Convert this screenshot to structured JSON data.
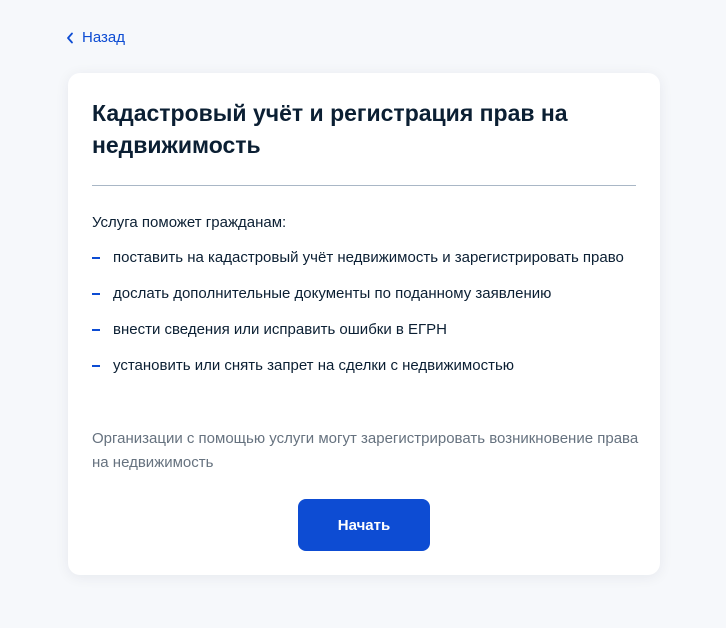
{
  "nav": {
    "back_label": "Назад"
  },
  "card": {
    "title": "Кадастровый учёт и регистрация прав на недвижимость",
    "intro": "Услуга поможет гражданам:",
    "items": [
      "поставить на кадастровый учёт недвижимость и зарегистрировать право",
      "дослать дополнительные документы по поданному заявлению",
      "внести сведения или исправить ошибки в ЕГРН",
      "установить или снять запрет на сделки с недвижимостью"
    ],
    "note": "Организации с помощью услуги могут зарегистрировать возникновение права на недвижимость",
    "start_label": "Начать"
  },
  "colors": {
    "accent": "#0d4cd3",
    "text": "#0b1f33",
    "muted": "#66727f",
    "background": "#f6f8fb"
  },
  "icons": {
    "back": "chevron-left-icon",
    "bullet": "dash-bullet"
  }
}
